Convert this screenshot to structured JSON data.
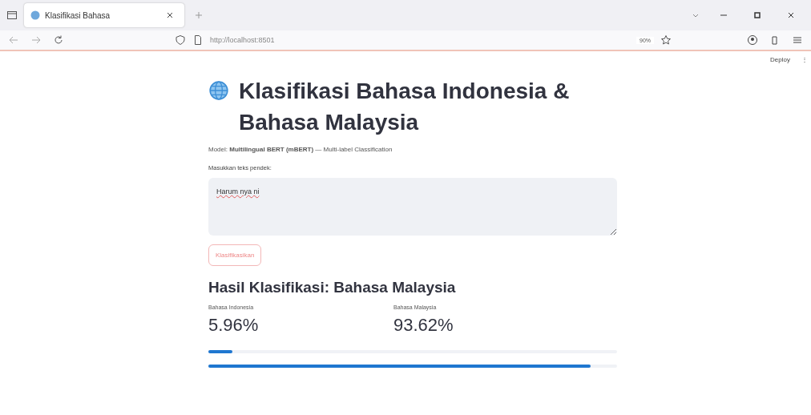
{
  "browser": {
    "tab": {
      "title": "Klasifikasi Bahasa",
      "selected": true
    },
    "url": "http://localhost:8501",
    "zoom": "90%"
  },
  "toolbar": {
    "deploy": "Deploy",
    "menu": "⋮"
  },
  "title": "Klasifikasi Bahasa Indonesia & Bahasa Malaysia",
  "subtitle": "Model: **Multilingual BERT (mBERT)** — Multi-label Classification",
  "input": {
    "label": "Masukkan teks pendek:",
    "value": "Harum nya ni"
  },
  "button": "Klasifikasikan",
  "result_heading": "Hasil Klasifikasi: Bahasa Malaysia",
  "metrics": [
    {
      "label": "Bahasa Indonesia",
      "value": "5.96%"
    },
    {
      "label": "Bahasa Malaysia",
      "value": "93.62%"
    }
  ],
  "bars": [
    {
      "level": 0.0596
    },
    {
      "level": 0.9362
    }
  ]
}
